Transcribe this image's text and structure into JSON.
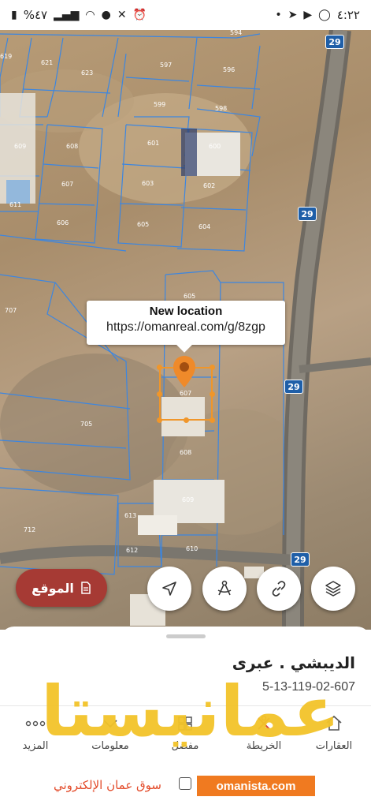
{
  "status_bar": {
    "time": "٤:٢٢",
    "battery": "%٤٧"
  },
  "map": {
    "road_number": "29",
    "plots": [
      "594",
      "621",
      "623",
      "597",
      "596",
      "599",
      "598",
      "609",
      "608",
      "601",
      "600",
      "607",
      "603",
      "602",
      "611",
      "606",
      "605",
      "604",
      "707",
      "705",
      "606",
      "708",
      "609",
      "613",
      "712",
      "612",
      "610",
      "607"
    ],
    "tooltip": {
      "title": "New location",
      "url": "https://omanreal.com/g/8zgp"
    },
    "selected_plot": "607"
  },
  "controls": {
    "location_button": "الموقع"
  },
  "sheet": {
    "place_title": "الديبشي . عبرى",
    "place_code": "5-13-119-02-607"
  },
  "bottom_nav": [
    {
      "label": "العقارات",
      "icon": "home-icon"
    },
    {
      "label": "الخريطة",
      "icon": "map-icon"
    },
    {
      "label": "مفضل",
      "icon": "favorite-icon"
    },
    {
      "label": "معلومات",
      "icon": "info-icon"
    },
    {
      "label": "المزيد",
      "icon": "more-icon"
    }
  ],
  "watermark": {
    "logo_text": "عمانيستا",
    "slogan": "سوق عمان الإلكتروني",
    "domain": "omanista.com"
  }
}
